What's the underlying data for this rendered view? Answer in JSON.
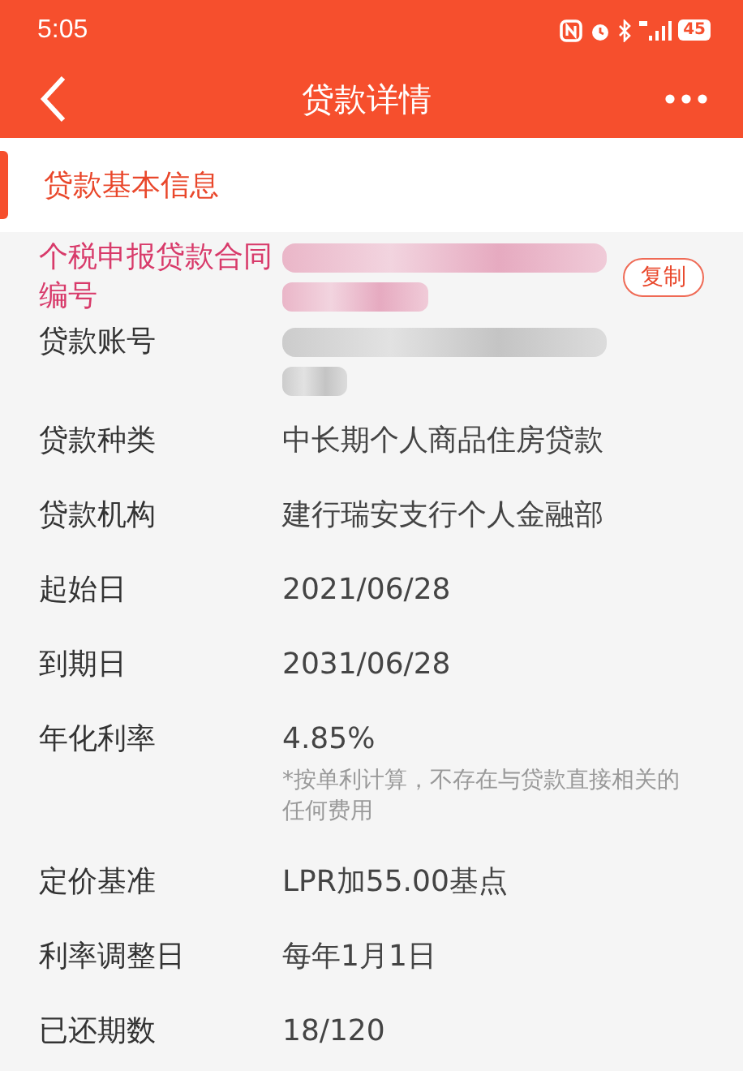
{
  "status_bar": {
    "time": "5:05",
    "battery": "45"
  },
  "header": {
    "title": "贷款详情"
  },
  "section": {
    "title": "贷款基本信息"
  },
  "rows": [
    {
      "kind": "redacted",
      "label": "个税申报贷款合同编号",
      "highlight": true,
      "action": "复制"
    },
    {
      "kind": "redacted",
      "label": "贷款账号",
      "highlight": false
    },
    {
      "kind": "text",
      "label": "贷款种类",
      "value": "中长期个人商品住房贷款",
      "highlight": false
    },
    {
      "kind": "text",
      "label": "贷款机构",
      "value": "建行瑞安支行个人金融部",
      "highlight": false
    },
    {
      "kind": "text",
      "label": "起始日",
      "value": "2021/06/28",
      "highlight": false
    },
    {
      "kind": "text",
      "label": "到期日",
      "value": "2031/06/28",
      "highlight": false
    },
    {
      "kind": "text",
      "label": "年化利率",
      "value": "4.85%",
      "note": "*按单利计算，不存在与贷款直接相关的任何费用",
      "highlight": false
    },
    {
      "kind": "text",
      "label": "定价基准",
      "value": "LPR加55.00基点",
      "highlight": false
    },
    {
      "kind": "text",
      "label": "利率调整日",
      "value": "每年1月1日",
      "highlight": false
    },
    {
      "kind": "text",
      "label": "已还期数",
      "value": "18/120",
      "highlight": false
    }
  ]
}
